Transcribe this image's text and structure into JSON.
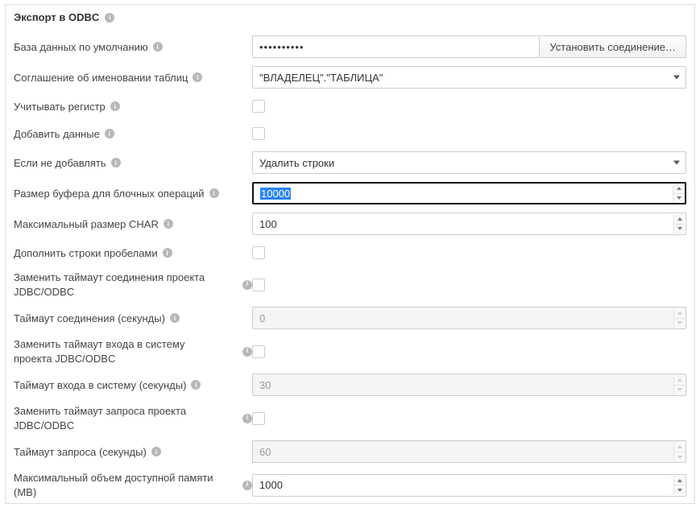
{
  "header": {
    "title": "Экспорт в ODBC"
  },
  "fields": {
    "default_db": {
      "label": "База данных по умолчанию",
      "value": "••••••••••",
      "button": "Установить соединение…"
    },
    "naming": {
      "label": "Соглашение об именовании таблиц",
      "value": "\"ВЛАДЕЛЕЦ\".\"ТАБЛИЦА\""
    },
    "case_sensitive": {
      "label": "Учитывать регистр"
    },
    "append": {
      "label": "Добавить данные"
    },
    "if_not_append": {
      "label": "Если не добавлять",
      "value": "Удалить строки"
    },
    "buffer": {
      "label": "Размер буфера для блочных операций",
      "value": "10000"
    },
    "max_char": {
      "label": "Максимальный размер CHAR",
      "value": "100"
    },
    "pad_spaces": {
      "label": "Дополнить строки пробелами"
    },
    "override_conn_to": {
      "label": "Заменить таймаут соединения проекта JDBC/ODBC"
    },
    "conn_to": {
      "label": "Таймаут соединения (секунды)",
      "value": "0"
    },
    "override_login_to": {
      "label": "Заменить таймаут входа в систему проекта JDBC/ODBC"
    },
    "login_to": {
      "label": "Таймаут входа в систему (секунды)",
      "value": "30"
    },
    "override_query_to": {
      "label": "Заменить таймаут запроса проекта JDBC/ODBC"
    },
    "query_to": {
      "label": "Таймаут запроса (секунды)",
      "value": "60"
    },
    "max_mem": {
      "label": "Максимальный объем доступной памяти (MB)",
      "value": "1000"
    }
  }
}
